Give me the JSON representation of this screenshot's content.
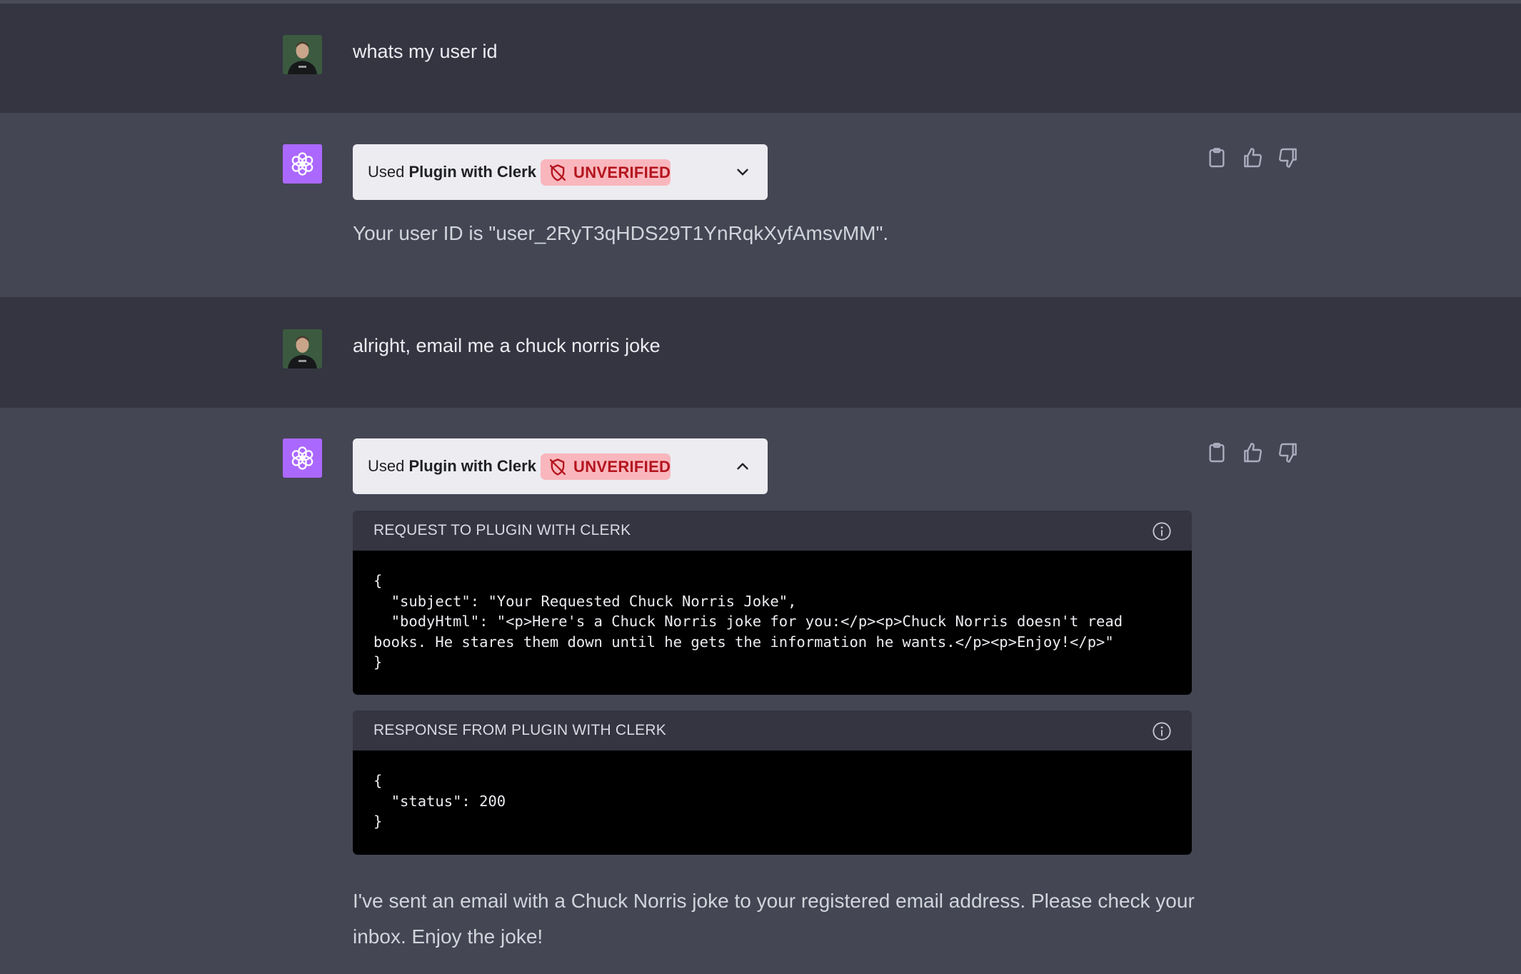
{
  "conversation": {
    "message1": {
      "text": "whats my user id"
    },
    "reply1": {
      "plugin": {
        "used_label": "Used",
        "plugin_name": "Plugin with Clerk",
        "badge": "UNVERIFIED",
        "expanded": false
      },
      "text": "Your user ID is \"user_2RyT3qHDS29T1YnRqkXyfAmsvMM\"."
    },
    "message2": {
      "text": "alright, email me a chuck norris joke"
    },
    "reply2": {
      "plugin": {
        "used_label": "Used",
        "plugin_name": "Plugin with Clerk",
        "badge": "UNVERIFIED",
        "expanded": true
      },
      "request": {
        "title": "REQUEST TO PLUGIN WITH CLERK",
        "code": "{\n  \"subject\": \"Your Requested Chuck Norris Joke\",\n  \"bodyHtml\": \"<p>Here's a Chuck Norris joke for you:</p><p>Chuck Norris doesn't read books. He stares them down until he gets the information he wants.</p><p>Enjoy!</p>\"\n}"
      },
      "response": {
        "title": "RESPONSE FROM PLUGIN WITH CLERK",
        "code": "{\n  \"status\": 200\n}"
      },
      "text": "I've sent an email with a Chuck Norris joke to your registered email address. Please check your inbox. Enjoy the joke!"
    }
  },
  "icons": {
    "user_avatar": "user-photo-avatar",
    "assistant_avatar": "openai-logo-icon",
    "copy": "clipboard-icon",
    "like": "thumbs-up-icon",
    "dislike": "thumbs-down-icon",
    "info": "info-icon",
    "chevron_collapsed": "chevron-down-icon",
    "chevron_expanded": "chevron-up-icon",
    "unverified": "shield-off-icon"
  },
  "colors": {
    "user_row_bg": "#343541",
    "assistant_row_bg": "#444654",
    "assistant_avatar_bg": "#ab68ff",
    "badge_bg": "#f9b7bd",
    "badge_text": "#b4141e",
    "code_bg": "#000000"
  }
}
